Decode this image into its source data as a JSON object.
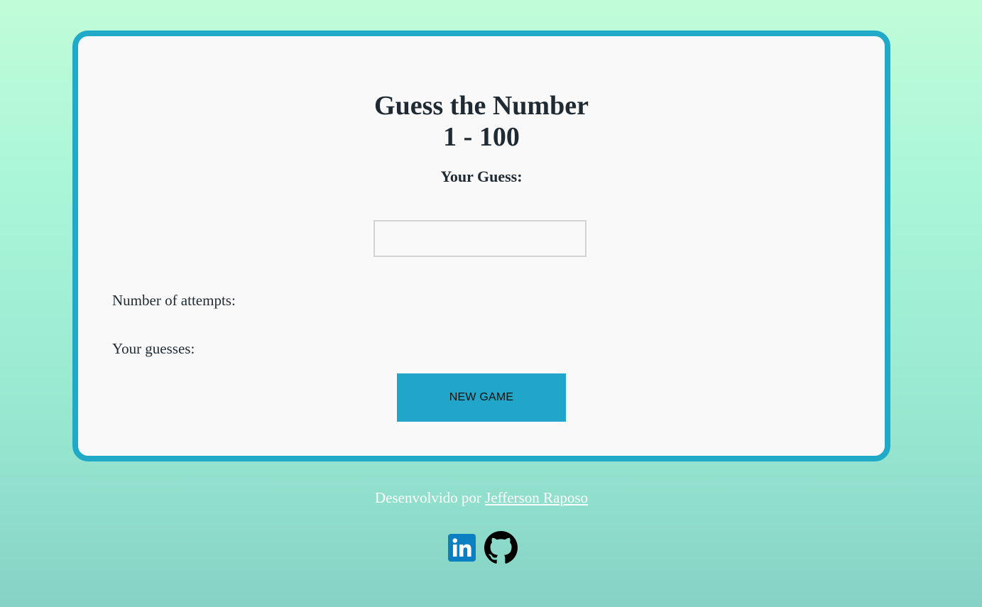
{
  "game": {
    "title_line1": "Guess the Number",
    "title_line2": "1 - 100",
    "guess_label": "Your Guess:",
    "guess_value": "",
    "attempts_label": "Number of attempts:",
    "guesses_label": "Your guesses:",
    "new_game_label": "NEW GAME"
  },
  "footer": {
    "credit_prefix": "Desenvolvido por",
    "author_link": "Jefferson Raposo",
    "social_icons": [
      "linkedin-icon",
      "github-icon"
    ]
  },
  "colors": {
    "accent": "#21a9c8",
    "button": "#21a6c9",
    "linkedin": "#0a7fc2",
    "github": "#000000",
    "card_bg": "#f9f9f9"
  }
}
